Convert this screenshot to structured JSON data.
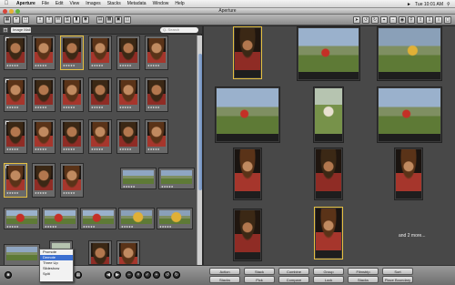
{
  "menubar": {
    "app": "Aperture",
    "items": [
      "File",
      "Edit",
      "View",
      "Images",
      "Stacks",
      "Metadata",
      "Window",
      "Help"
    ],
    "clock": "Tue 10:01 AM"
  },
  "window": {
    "title": "Aperture"
  },
  "browser": {
    "query_label": "Image Mail",
    "search_placeholder": "Q- Search",
    "thumb_caption": "★★★★★"
  },
  "viewer": {
    "more_label": "and 2 more..."
  },
  "popup_menu": {
    "items": [
      "Promote",
      "Demote",
      "Three Up",
      "Slideshow",
      "Split"
    ]
  },
  "bottom_bar": {
    "buttons": [
      "Action",
      "Stack",
      "Combine",
      "Group",
      "Filmstrip",
      "Sort",
      "Stacks",
      "Pick",
      "Compare",
      "Lock",
      "Stacks",
      "Place Boundary"
    ]
  },
  "colors": {
    "selection": "#e6c040",
    "viewer_bg": "#484848",
    "browser_bg": "#4d4d4d"
  },
  "icons": {
    "apple": "apple-icon",
    "back": "back-icon",
    "forward": "forward-icon"
  }
}
